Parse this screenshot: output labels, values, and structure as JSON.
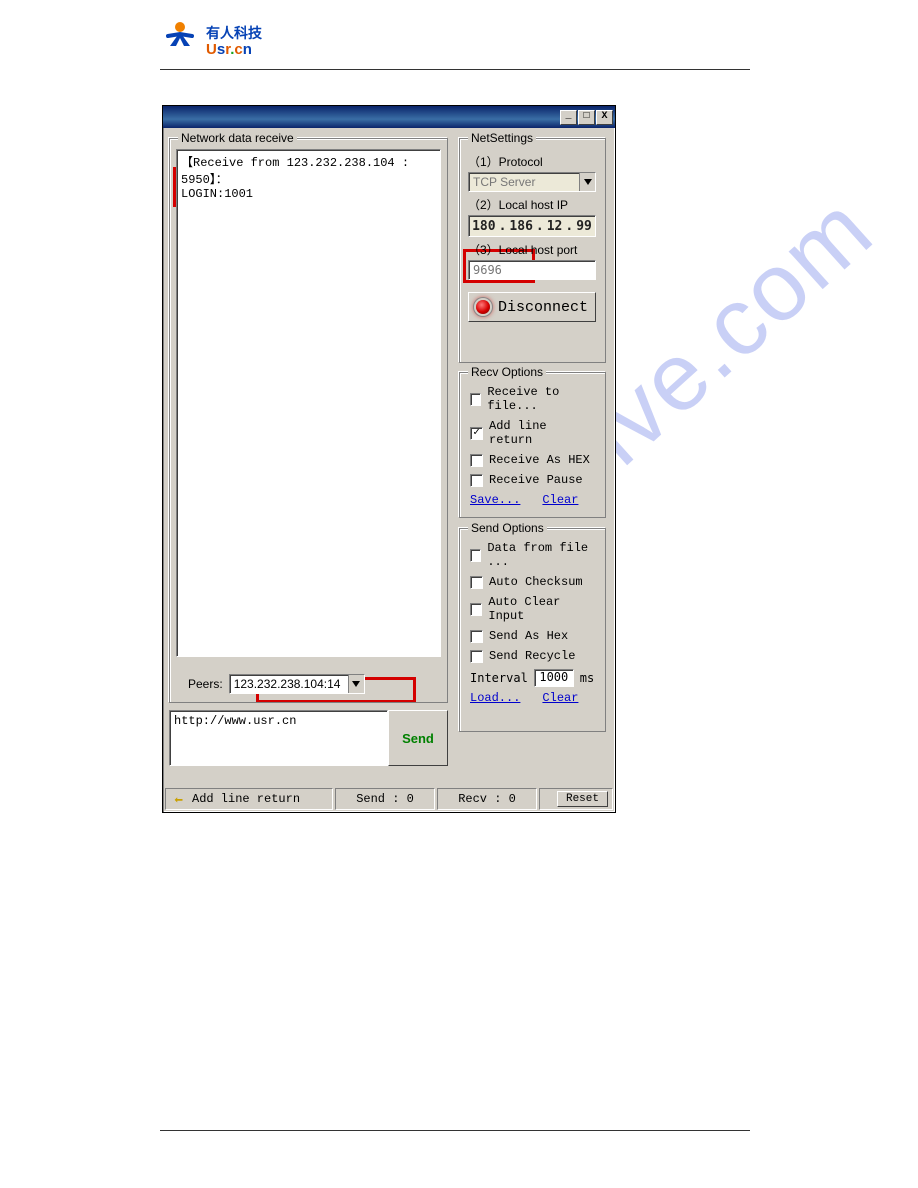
{
  "logo": {
    "cn": "有人科技",
    "en": "Usr.cn"
  },
  "watermark": "manualshive.com",
  "recv": {
    "legend": "Network data receive",
    "line1": "【Receive from 123.232.238.104 : 5950】：",
    "line2": "LOGIN:1001",
    "peers_label": "Peers:",
    "peers_value": "123.232.238.104:14"
  },
  "send": {
    "text": "http://www.usr.cn",
    "button": "Send"
  },
  "net": {
    "legend": "NetSettings",
    "protocol_label": "（1）Protocol",
    "protocol_value": "TCP Server",
    "ip_label": "（2）Local host IP",
    "ip_octets": [
      "180",
      "186",
      "12",
      "99"
    ],
    "port_label": "（3）Local host port",
    "port_value": "9696",
    "disconnect": "Disconnect"
  },
  "recv_opts": {
    "legend": "Recv Options",
    "items": [
      {
        "label": "Receive to file...",
        "checked": false
      },
      {
        "label": "Add line return",
        "checked": true
      },
      {
        "label": "Receive As HEX",
        "checked": false
      },
      {
        "label": "Receive Pause",
        "checked": false
      }
    ],
    "save": "Save...",
    "clear": "Clear"
  },
  "send_opts": {
    "legend": "Send Options",
    "items": [
      {
        "label": "Data from file ...",
        "checked": false
      },
      {
        "label": "Auto Checksum",
        "checked": false
      },
      {
        "label": "Auto Clear Input",
        "checked": false
      },
      {
        "label": "Send As Hex",
        "checked": false
      },
      {
        "label": "Send Recycle",
        "checked": false
      }
    ],
    "interval_label": "Interval",
    "interval_value": "1000",
    "interval_unit": "ms",
    "load": "Load...",
    "clear": "Clear"
  },
  "status": {
    "addline": "Add line return",
    "send": "Send : 0",
    "recv": "Recv : 0",
    "reset": "Reset"
  },
  "titlebar": {
    "min": "_",
    "max": "□",
    "close": "X"
  }
}
